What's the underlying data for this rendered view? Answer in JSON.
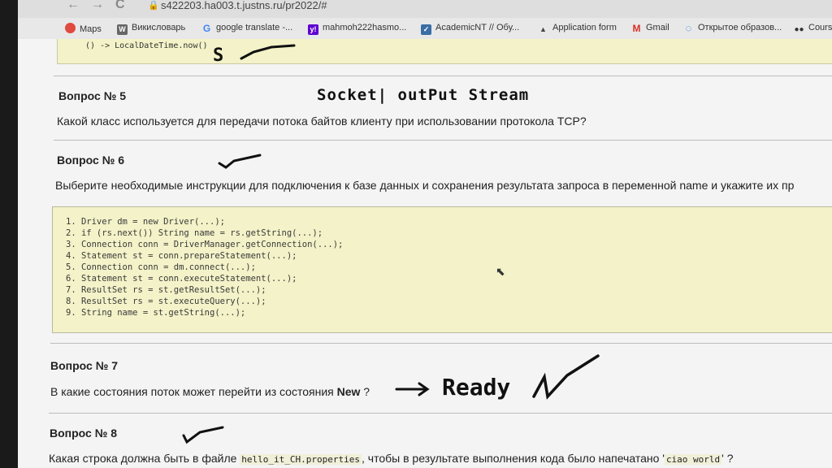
{
  "browser": {
    "back": "←",
    "forward": "→",
    "reload": "C",
    "url": "s422203.ha003.t.justns.ru/pr2022/#"
  },
  "bookmarks": [
    {
      "label": "Maps",
      "icon": "map-pin-icon",
      "color": "#e04a3f"
    },
    {
      "label": "Викисловарь",
      "icon": "wiki-icon",
      "color": "#666666"
    },
    {
      "label": "google translate -...",
      "icon": "google-icon",
      "color": "#4285f4"
    },
    {
      "label": "mahmoh222hasmo...",
      "icon": "yahoo-icon",
      "color": "#5f01d1"
    },
    {
      "label": "AcademicNT // Обу...",
      "icon": "academic-icon",
      "color": "#3a6ea5"
    },
    {
      "label": "Application form",
      "icon": "triangle-icon",
      "color": "#444444"
    },
    {
      "label": "Gmail",
      "icon": "gmail-icon",
      "color": "#d93025"
    },
    {
      "label": "Открытое образов...",
      "icon": "circle-icon",
      "color": "#1a73e8"
    },
    {
      "label": "Cours",
      "icon": "dots-icon",
      "color": "#333333"
    }
  ],
  "prev_code": "() -> LocalDateTime.now()",
  "questions": {
    "q5": {
      "title": "Вопрос № 5",
      "text": "Какой класс используется для передачи потока байтов клиенту при использовании протокола TCP?"
    },
    "q6": {
      "title": "Вопрос № 6",
      "text": "Выберите необходимые инструкции для подключения к базе данных и сохранения результата запроса в переменной name и укажите их пр"
    },
    "q7": {
      "title": "Вопрос № 7",
      "text_before": "В какие состояния поток может перейти из состояния ",
      "bold": "New",
      "text_after": " ?"
    },
    "q8": {
      "title": "Вопрос № 8",
      "text_a": "Какая строка должна быть в файле ",
      "code_a": "hello_it_CH.properties",
      "text_b": ", чтобы в результате выполнения кода было напечатано '",
      "code_b": "ciao world",
      "text_c": "' ?"
    }
  },
  "code_lines": [
    "1. Driver dm = new Driver(...);",
    "2. if (rs.next()) String name = rs.getString(...);",
    "3. Connection conn = DriverManager.getConnection(...);",
    "4. Statement st = conn.prepareStatement(...);",
    "5. Connection conn = dm.connect(...);",
    "6. Statement st = conn.executeStatement(...);",
    "7. ResultSet rs = st.getResultSet(...);",
    "8. ResultSet rs = st.executeQuery(...);",
    "9. String name = st.getString(...);"
  ],
  "handwriting": {
    "s_mark": "S",
    "q5_answer": "Socket| outPut Stream",
    "q7_answer": "Ready"
  }
}
